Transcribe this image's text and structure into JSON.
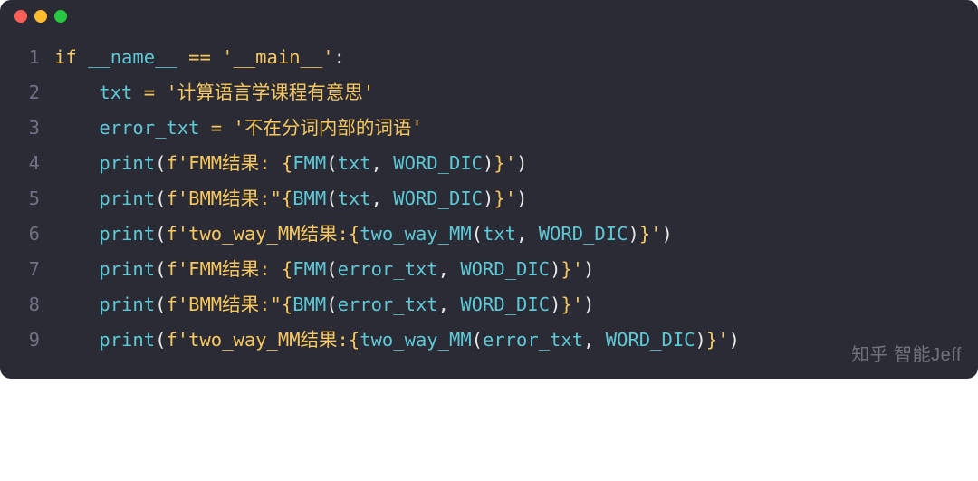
{
  "window": {
    "traffic_lights": {
      "close": "#ff5f57",
      "minimize": "#febc2e",
      "zoom": "#28c840"
    }
  },
  "code": {
    "lines": [
      {
        "n": "1",
        "indent": "",
        "tokens": [
          {
            "t": "if ",
            "c": "tok-kw"
          },
          {
            "t": "__name__",
            "c": "tok-name"
          },
          {
            "t": " == ",
            "c": "tok-op"
          },
          {
            "t": "'__main__'",
            "c": "tok-str"
          },
          {
            "t": ":",
            "c": "tok-punc"
          }
        ]
      },
      {
        "n": "2",
        "indent": "    ",
        "tokens": [
          {
            "t": "txt",
            "c": "tok-name"
          },
          {
            "t": " = ",
            "c": "tok-op"
          },
          {
            "t": "'计算语言学课程有意思'",
            "c": "tok-str"
          }
        ]
      },
      {
        "n": "3",
        "indent": "    ",
        "tokens": [
          {
            "t": "error_txt",
            "c": "tok-name"
          },
          {
            "t": " = ",
            "c": "tok-op"
          },
          {
            "t": "'不在分词内部的词语'",
            "c": "tok-str"
          }
        ]
      },
      {
        "n": "4",
        "indent": "    ",
        "tokens": [
          {
            "t": "print",
            "c": "tok-func"
          },
          {
            "t": "(",
            "c": "tok-punc"
          },
          {
            "t": "f'FMM结果: ",
            "c": "tok-fmt"
          },
          {
            "t": "{",
            "c": "tok-fmt"
          },
          {
            "t": "FMM",
            "c": "tok-interp"
          },
          {
            "t": "(",
            "c": "tok-punc"
          },
          {
            "t": "txt",
            "c": "tok-interp"
          },
          {
            "t": ", ",
            "c": "tok-punc"
          },
          {
            "t": "WORD_DIC",
            "c": "tok-interp"
          },
          {
            "t": ")",
            "c": "tok-punc"
          },
          {
            "t": "}",
            "c": "tok-fmt"
          },
          {
            "t": "'",
            "c": "tok-fmt"
          },
          {
            "t": ")",
            "c": "tok-punc"
          }
        ]
      },
      {
        "n": "5",
        "indent": "    ",
        "tokens": [
          {
            "t": "print",
            "c": "tok-func"
          },
          {
            "t": "(",
            "c": "tok-punc"
          },
          {
            "t": "f'BMM结果:\"",
            "c": "tok-fmt"
          },
          {
            "t": "{",
            "c": "tok-fmt"
          },
          {
            "t": "BMM",
            "c": "tok-interp"
          },
          {
            "t": "(",
            "c": "tok-punc"
          },
          {
            "t": "txt",
            "c": "tok-interp"
          },
          {
            "t": ", ",
            "c": "tok-punc"
          },
          {
            "t": "WORD_DIC",
            "c": "tok-interp"
          },
          {
            "t": ")",
            "c": "tok-punc"
          },
          {
            "t": "}",
            "c": "tok-fmt"
          },
          {
            "t": "'",
            "c": "tok-fmt"
          },
          {
            "t": ")",
            "c": "tok-punc"
          }
        ]
      },
      {
        "n": "6",
        "indent": "    ",
        "tokens": [
          {
            "t": "print",
            "c": "tok-func"
          },
          {
            "t": "(",
            "c": "tok-punc"
          },
          {
            "t": "f'two_way_MM结果:",
            "c": "tok-fmt"
          },
          {
            "t": "{",
            "c": "tok-fmt"
          },
          {
            "t": "two_way_MM",
            "c": "tok-interp"
          },
          {
            "t": "(",
            "c": "tok-punc"
          },
          {
            "t": "txt",
            "c": "tok-interp"
          },
          {
            "t": ", ",
            "c": "tok-punc"
          },
          {
            "t": "WORD_DIC",
            "c": "tok-interp"
          },
          {
            "t": ")",
            "c": "tok-punc"
          },
          {
            "t": "}",
            "c": "tok-fmt"
          },
          {
            "t": "'",
            "c": "tok-fmt"
          },
          {
            "t": ")",
            "c": "tok-punc"
          }
        ]
      },
      {
        "n": "7",
        "indent": "    ",
        "tokens": [
          {
            "t": "print",
            "c": "tok-func"
          },
          {
            "t": "(",
            "c": "tok-punc"
          },
          {
            "t": "f'FMM结果: ",
            "c": "tok-fmt"
          },
          {
            "t": "{",
            "c": "tok-fmt"
          },
          {
            "t": "FMM",
            "c": "tok-interp"
          },
          {
            "t": "(",
            "c": "tok-punc"
          },
          {
            "t": "error_txt",
            "c": "tok-interp"
          },
          {
            "t": ", ",
            "c": "tok-punc"
          },
          {
            "t": "WORD_DIC",
            "c": "tok-interp"
          },
          {
            "t": ")",
            "c": "tok-punc"
          },
          {
            "t": "}",
            "c": "tok-fmt"
          },
          {
            "t": "'",
            "c": "tok-fmt"
          },
          {
            "t": ")",
            "c": "tok-punc"
          }
        ]
      },
      {
        "n": "8",
        "indent": "    ",
        "tokens": [
          {
            "t": "print",
            "c": "tok-func"
          },
          {
            "t": "(",
            "c": "tok-punc"
          },
          {
            "t": "f'BMM结果:\"",
            "c": "tok-fmt"
          },
          {
            "t": "{",
            "c": "tok-fmt"
          },
          {
            "t": "BMM",
            "c": "tok-interp"
          },
          {
            "t": "(",
            "c": "tok-punc"
          },
          {
            "t": "error_txt",
            "c": "tok-interp"
          },
          {
            "t": ", ",
            "c": "tok-punc"
          },
          {
            "t": "WORD_DIC",
            "c": "tok-interp"
          },
          {
            "t": ")",
            "c": "tok-punc"
          },
          {
            "t": "}",
            "c": "tok-fmt"
          },
          {
            "t": "'",
            "c": "tok-fmt"
          },
          {
            "t": ")",
            "c": "tok-punc"
          }
        ]
      },
      {
        "n": "9",
        "indent": "    ",
        "tokens": [
          {
            "t": "print",
            "c": "tok-func"
          },
          {
            "t": "(",
            "c": "tok-punc"
          },
          {
            "t": "f'two_way_MM结果:",
            "c": "tok-fmt"
          },
          {
            "t": "{",
            "c": "tok-fmt"
          },
          {
            "t": "two_way_MM",
            "c": "tok-interp"
          },
          {
            "t": "(",
            "c": "tok-punc"
          },
          {
            "t": "error_txt",
            "c": "tok-interp"
          },
          {
            "t": ", ",
            "c": "tok-punc"
          },
          {
            "t": "WORD_DIC",
            "c": "tok-interp"
          },
          {
            "t": ")",
            "c": "tok-punc"
          },
          {
            "t": "}",
            "c": "tok-fmt"
          },
          {
            "t": "'",
            "c": "tok-fmt"
          },
          {
            "t": ")",
            "c": "tok-punc"
          }
        ]
      }
    ]
  },
  "watermark": "知乎 智能Jeff"
}
